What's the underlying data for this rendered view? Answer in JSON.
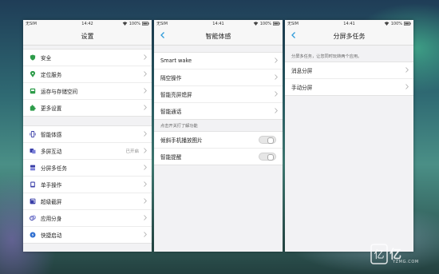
{
  "colors": {
    "accent": "#2f9bd9",
    "chevron": "#aaaaaa"
  },
  "screens": [
    {
      "status": {
        "carrier": "无SIM",
        "time": "14:42",
        "battery": "100%"
      },
      "title": "设置",
      "section1": [
        {
          "label": "安全",
          "icon": "shield-icon",
          "color": "#2e9c4a"
        },
        {
          "label": "定位服务",
          "icon": "location-pin-icon",
          "color": "#2e9c4a"
        },
        {
          "label": "运存与存储空间",
          "icon": "storage-icon",
          "color": "#2e9c4a"
        },
        {
          "label": "更多设置",
          "icon": "puzzle-icon",
          "color": "#2e9c4a"
        }
      ],
      "section2": [
        {
          "label": "智能体感",
          "icon": "phone-vibrate-icon",
          "color": "#3a3fa8",
          "value": ""
        },
        {
          "label": "多屏互动",
          "icon": "multi-screen-icon",
          "color": "#3a3fa8",
          "value": "已开启"
        },
        {
          "label": "分屏多任务",
          "icon": "split-screen-icon",
          "color": "#3a3fa8",
          "value": ""
        },
        {
          "label": "单手操作",
          "icon": "hand-icon",
          "color": "#3a3fa8",
          "value": ""
        },
        {
          "label": "超级截屏",
          "icon": "screenshot-icon",
          "color": "#3a3fa8",
          "value": ""
        },
        {
          "label": "应用分身",
          "icon": "clone-icon",
          "color": "#3a3fa8",
          "value": ""
        },
        {
          "label": "快捷启动",
          "icon": "quick-launch-icon",
          "color": "#2f6fd0",
          "value": ""
        }
      ]
    },
    {
      "status": {
        "carrier": "无SIM",
        "time": "14:41",
        "battery": "100%"
      },
      "title": "智能体感",
      "section1": [
        {
          "label": "Smart wake"
        },
        {
          "label": "隔空操作"
        },
        {
          "label": "智能亮屏熄屏"
        },
        {
          "label": "智能通话"
        }
      ],
      "hint": "点击开关打了解功能",
      "section2": [
        {
          "label": "倾斜手机播放图片"
        },
        {
          "label": "智能提醒"
        }
      ]
    },
    {
      "status": {
        "carrier": "无SIM",
        "time": "14:41",
        "battery": "100%"
      },
      "title": "分屏多任务",
      "hint": "分屏多任务，让您同时玩转两个应用。",
      "section1": [
        {
          "label": "消息分屏"
        },
        {
          "label": "手动分屏"
        }
      ]
    }
  ],
  "watermark": {
    "logo": "亿",
    "text": "亿",
    "site": "YZMG.COM"
  }
}
